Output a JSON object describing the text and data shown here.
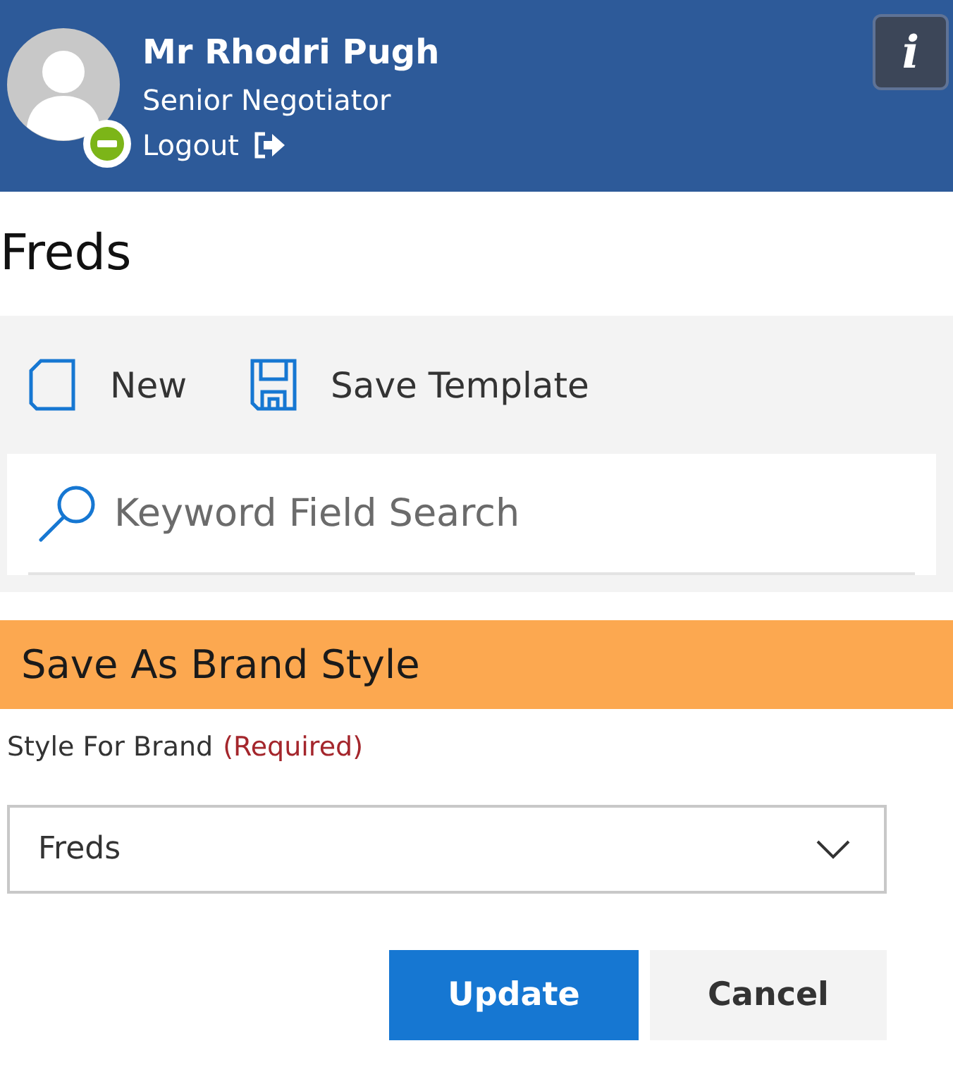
{
  "header": {
    "user": {
      "name": "Mr Rhodri Pugh",
      "role": "Senior Negotiator",
      "logout": "Logout"
    },
    "info_button": {
      "label": "i"
    }
  },
  "page": {
    "title": "Freds"
  },
  "toolbar": {
    "items": [
      {
        "kind": "new",
        "label": "New"
      },
      {
        "kind": "save",
        "label": "Save Template"
      }
    ]
  },
  "search": {
    "placeholder": "Keyword Field Search"
  },
  "section": {
    "title": "Save As Brand Style",
    "field": {
      "label": "Style For Brand",
      "required_note": "(Required)",
      "value": "Freds"
    }
  },
  "buttons": [
    {
      "kind": "primary",
      "label": "Update"
    },
    {
      "kind": "secondary",
      "label": "Cancel"
    }
  ]
}
